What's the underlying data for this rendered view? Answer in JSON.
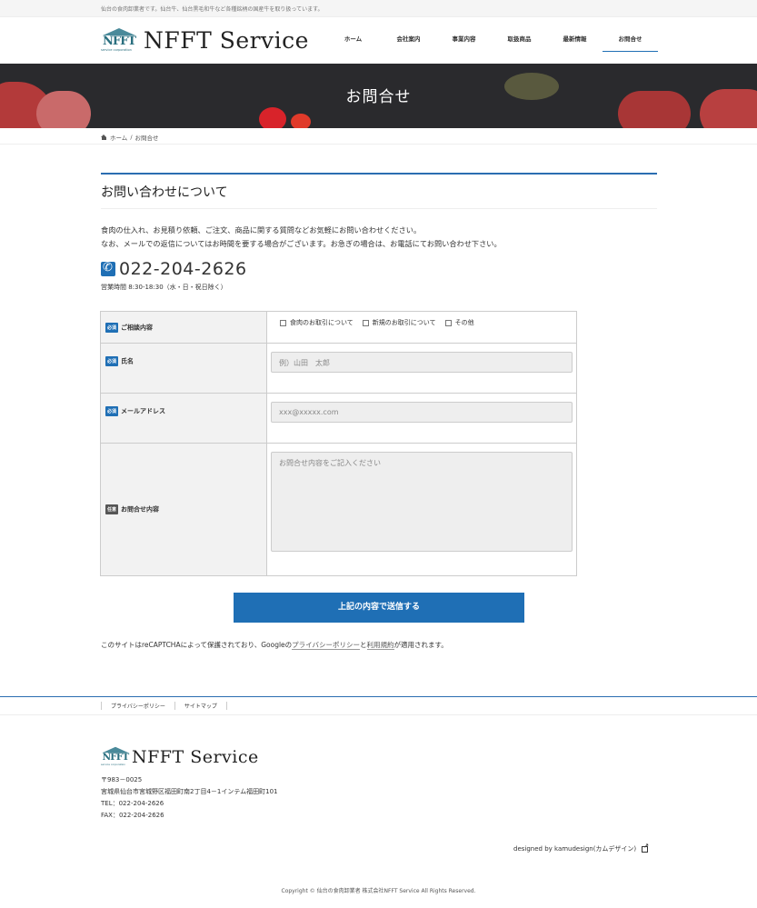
{
  "topbar": {
    "tagline": "仙台の食肉卸業者です。仙台牛、仙台黒毛和牛など各種銘柄の国産牛を取り扱っています。"
  },
  "header": {
    "logo_mark": "NFFT",
    "logo_sub": "service corporation",
    "logo_text": "NFFT Service",
    "nav": [
      "ホーム",
      "会社案内",
      "事業内容",
      "取扱商品",
      "最新情報",
      "お問合せ"
    ]
  },
  "hero": {
    "title": "お問合せ"
  },
  "breadcrumb": {
    "home": "ホーム",
    "sep": "/",
    "current": "お問合せ"
  },
  "section": {
    "title": "お問い合わせについて",
    "intro_1": "食肉の仕入れ、お見積り依頼、ご注文、商品に関する質問などお気軽にお問い合わせください。",
    "intro_2": "なお、メールでの返信についてはお時間を要する場合がございます。お急ぎの場合は、お電話にてお問い合わせ下さい。",
    "phone": "022-204-2626",
    "hours": "営業時間 8:30-18:30（水・日・祝日除く）"
  },
  "form": {
    "required": "必須",
    "optional": "任意",
    "topic_label": "ご相談内容",
    "topic_options": [
      "食肉のお取引について",
      "新規のお取引について",
      "その他"
    ],
    "name_label": "氏名",
    "name_placeholder": "例）山田　太郎",
    "email_label": "メールアドレス",
    "email_placeholder": "xxx@xxxxx.com",
    "message_label": "お問合せ内容",
    "message_placeholder": "お問合せ内容をご記入ください",
    "submit": "上記の内容で送信する"
  },
  "recaptcha": {
    "pre": "このサイトはreCAPTCHAによって保護されており、Googleの",
    "privacy": "プライバシーポリシー",
    "mid": "と",
    "terms": "利用規約",
    "post": "が適用されます。"
  },
  "footer": {
    "links": [
      "プライバシーポリシー",
      "サイトマップ"
    ],
    "logo_text": "NFFT Service",
    "zip": "〒983－0025",
    "address": "宮城県仙台市宮城野区福田町南2丁目4－1インテム福田町101",
    "tel": "TEL：022-204-2626",
    "fax": "FAX：022-204-2626",
    "designed_by": "designed by kamudesign(カムデザイン)",
    "copyright": "Copyright © 仙台の食肉卸業者 株式会社NFFT Service All Rights Reserved."
  }
}
